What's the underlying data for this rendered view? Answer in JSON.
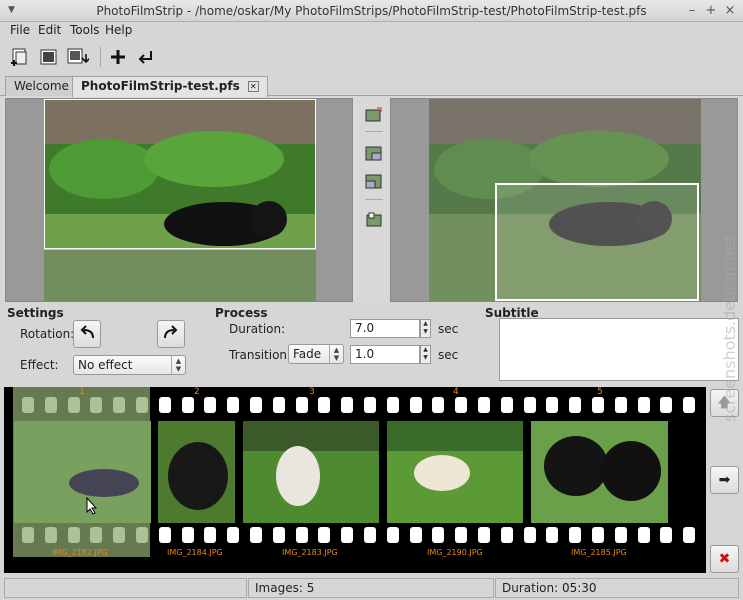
{
  "window": {
    "title": "PhotoFilmStrip - /home/oskar/My PhotoFilmStrips/PhotoFilmStrip-test/PhotoFilmStrip-test.pfs"
  },
  "menu": [
    "File",
    "Edit",
    "Tools",
    "Help"
  ],
  "tabs": [
    {
      "label": "Welcome"
    },
    {
      "label": "PhotoFilmStrip-test.pfs"
    }
  ],
  "settings": {
    "heading": "Settings",
    "rotation_label": "Rotation:",
    "effect_label": "Effect:",
    "effect_value": "No effect"
  },
  "process": {
    "heading": "Process",
    "duration_label": "Duration:",
    "duration_value": "7.0",
    "duration_unit": "sec",
    "transition_label": "Transition:",
    "transition_value": "Fade",
    "transition_duration": "1.0",
    "transition_unit": "sec"
  },
  "subtitle": {
    "heading": "Subtitle",
    "value": ""
  },
  "filmstrip": {
    "frames": [
      {
        "number": "1",
        "file": "IMG_2182.JPG",
        "selected": true
      },
      {
        "number": "2",
        "file": "IMG_2184.JPG",
        "selected": false
      },
      {
        "number": "3",
        "file": "IMG_2183.JPG",
        "selected": false
      },
      {
        "number": "4",
        "file": "IMG_2190.JPG",
        "selected": false
      },
      {
        "number": "5",
        "file": "IMG_2185.JPG",
        "selected": false
      }
    ]
  },
  "status": {
    "cell1": "",
    "images": "Images: 5",
    "duration": "Duration: 05:30"
  },
  "watermark": "screenshots.debian.net",
  "colors": {
    "accent": "#e08a1c",
    "delete": "#cc1111"
  }
}
